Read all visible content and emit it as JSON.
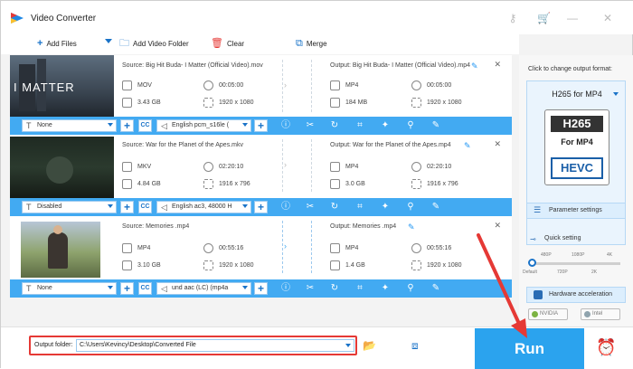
{
  "app": {
    "title": "Video Converter",
    "logo_color": "#2196f3",
    "key_icon": "key-icon",
    "cart_icon": "cart-icon"
  },
  "toolbar": {
    "add_files": "Add Files",
    "add_video_folder": "Add Video Folder",
    "clear": "Clear",
    "merge": "Merge"
  },
  "files": [
    {
      "source": "Source: Big Hit Buda- I Matter (Official Video).mov",
      "src_format": "MOV",
      "src_duration": "00:05:00",
      "src_size": "3.43 GB",
      "src_resolution": "1920 x 1080",
      "output": "Output: Big Hit Buda- I Matter (Official Video).mp4",
      "out_format": "MP4",
      "out_duration": "00:05:00",
      "out_size": "184 MB",
      "out_resolution": "1920 x 1080",
      "thumb_text": "I MATTER",
      "subtitle": "None",
      "audio": "English pcm_s16le (",
      "cc": "CC"
    },
    {
      "source": "Source: War for the Planet of the Apes.mkv",
      "src_format": "MKV",
      "src_duration": "02:20:10",
      "src_size": "4.84 GB",
      "src_resolution": "1916 x 796",
      "output": "Output: War for the Planet of the Apes.mp4",
      "out_format": "MP4",
      "out_duration": "02:20:10",
      "out_size": "3.0 GB",
      "out_resolution": "1916 x 796",
      "thumb_text": "",
      "subtitle": "Disabled",
      "audio": "English ac3, 48000 H",
      "cc": "CC"
    },
    {
      "source": "Source: Memories .mp4",
      "src_format": "MP4",
      "src_duration": "00:55:16",
      "src_size": "3.10 GB",
      "src_resolution": "1920 x 1080",
      "output": "Output: Memories .mp4",
      "out_format": "MP4",
      "out_duration": "00:55:16",
      "out_size": "1.4 GB",
      "out_resolution": "1920 x 1080",
      "thumb_text": "",
      "subtitle": "None",
      "audio": "und aac (LC) (mp4a",
      "cc": "CC"
    }
  ],
  "panel": {
    "hint": "Click to change output format:",
    "format_title": "H265 for MP4",
    "icon_top": "H265",
    "icon_mid": "For MP4",
    "icon_bottom": "HEVC",
    "parameter_settings": "Parameter settings",
    "quick_setting": "Quick setting",
    "ticks_top": [
      "480P",
      "1080P",
      "4K"
    ],
    "ticks_bottom": [
      "Default",
      "720P",
      "2K"
    ],
    "hw_accel": "Hardware acceleration",
    "nvidia": "NVIDIA",
    "intel": "Intel"
  },
  "bottom": {
    "output_label": "Output folder:",
    "output_path": "C:\\Users\\Kevincy\\Desktop\\Converted File",
    "run": "Run"
  },
  "colors": {
    "accent": "#42aaf2",
    "run": "#2ba3ee",
    "highlight": "#e53935"
  }
}
